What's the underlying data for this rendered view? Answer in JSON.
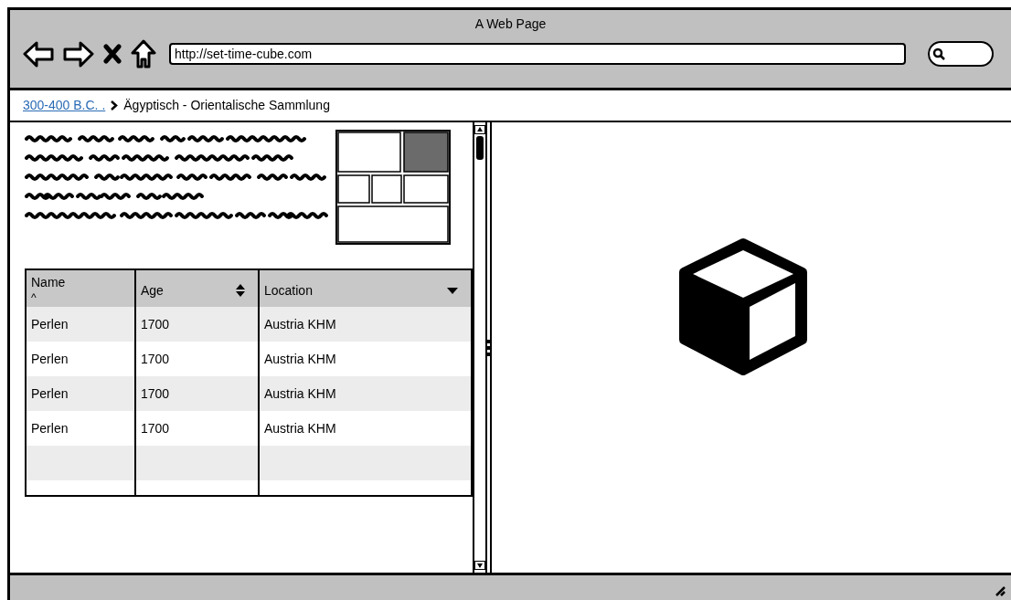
{
  "window": {
    "title": "A Web Page"
  },
  "address_bar": {
    "value": "http://set-time-cube.com"
  },
  "breadcrumb": {
    "link": "300-400 B.C. .",
    "current": "Ägyptisch - Orientalische Sammlung"
  },
  "table": {
    "columns": [
      {
        "label": "Name",
        "kind": "caret",
        "mark": "^"
      },
      {
        "label": "Age",
        "kind": "sort"
      },
      {
        "label": "Location",
        "kind": "dropdown"
      }
    ],
    "rows": [
      [
        "Perlen",
        "1700",
        "Austria KHM"
      ],
      [
        "Perlen",
        "1700",
        "Austria KHM"
      ],
      [
        "Perlen",
        "1700",
        "Austria KHM"
      ],
      [
        "Perlen",
        "1700",
        "Austria KHM"
      ]
    ]
  }
}
